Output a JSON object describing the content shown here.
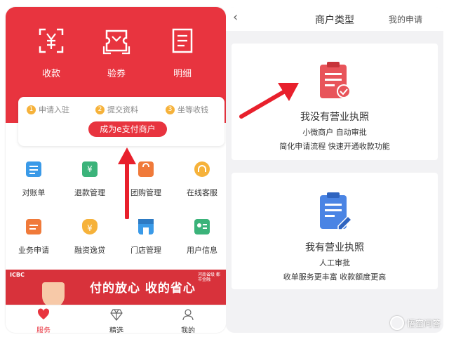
{
  "left_app": {
    "top_actions": [
      {
        "label": "收款",
        "icon": "yuan-scan-icon"
      },
      {
        "label": "验券",
        "icon": "ticket-scan-icon"
      },
      {
        "label": "明细",
        "icon": "document-list-icon"
      }
    ],
    "steps": [
      {
        "num": "1",
        "label": "申请入驻"
      },
      {
        "num": "2",
        "label": "提交资料"
      },
      {
        "num": "3",
        "label": "坐等收钱"
      }
    ],
    "cta_label": "成为e支付商户",
    "grid": [
      {
        "label": "对账单",
        "icon": "statement-icon"
      },
      {
        "label": "退款管理",
        "icon": "refund-icon"
      },
      {
        "label": "团购管理",
        "icon": "group-buy-icon"
      },
      {
        "label": "在线客服",
        "icon": "headset-icon"
      },
      {
        "label": "业务申请",
        "icon": "apply-icon"
      },
      {
        "label": "融资逸贷",
        "icon": "money-bag-icon"
      },
      {
        "label": "门店管理",
        "icon": "store-icon"
      },
      {
        "label": "用户信息",
        "icon": "user-card-icon"
      }
    ],
    "banner": {
      "brand": "ICBC",
      "text": "付的放心  收的省心",
      "badge": "河南省级 都市金融"
    },
    "tabs": [
      {
        "label": "服务",
        "active": true
      },
      {
        "label": "精选",
        "active": false
      },
      {
        "label": "我的",
        "active": false
      }
    ]
  },
  "right_app": {
    "back": "‹",
    "title": "商户类型",
    "link": "我的申请",
    "cards": [
      {
        "title": "我没有营业执照",
        "lines": [
          "小微商户 自动审批",
          "简化申请流程 快速开通收款功能"
        ],
        "icon": "clipboard-check-icon",
        "icon_color": "#e8545a"
      },
      {
        "title": "我有营业执照",
        "lines": [
          "人工审批",
          "收单服务更丰富 收款额度更高"
        ],
        "icon": "clipboard-edit-icon",
        "icon_color": "#4a84e4"
      }
    ]
  },
  "watermark": "悟空问答",
  "colors": {
    "brand_red": "#e8343f",
    "accent_orange": "#f6b23a",
    "accent_blue": "#4a84e4"
  }
}
